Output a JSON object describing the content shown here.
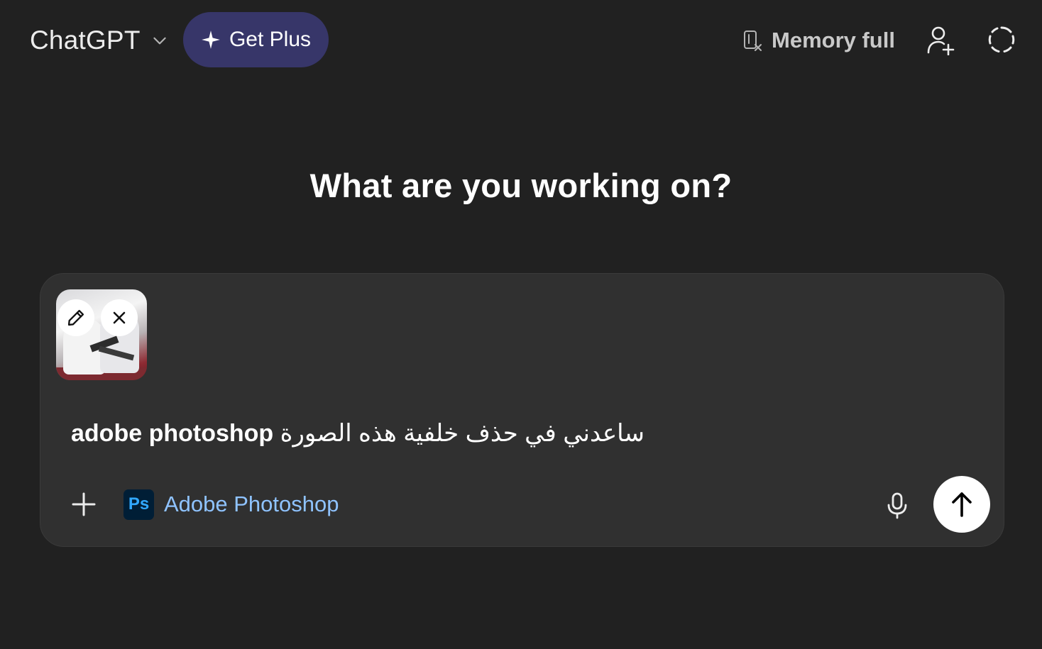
{
  "header": {
    "model_name": "ChatGPT",
    "upgrade_label": "Get Plus",
    "memory_status": "Memory full"
  },
  "main": {
    "headline": "What are you working on?"
  },
  "composer": {
    "prompt_app_text": "adobe photoshop",
    "prompt_arabic_text": "ساعدني في حذف خلفية هذه الصورة",
    "app_chip": {
      "logo_text": "Ps",
      "label": "Adobe Photoshop"
    }
  },
  "colors": {
    "background": "#212121",
    "composer_bg": "#303030",
    "upgrade_bg": "#373669",
    "app_label": "#8fc3ff",
    "ps_logo_bg": "#001e36",
    "ps_logo_text": "#31a8ff"
  }
}
